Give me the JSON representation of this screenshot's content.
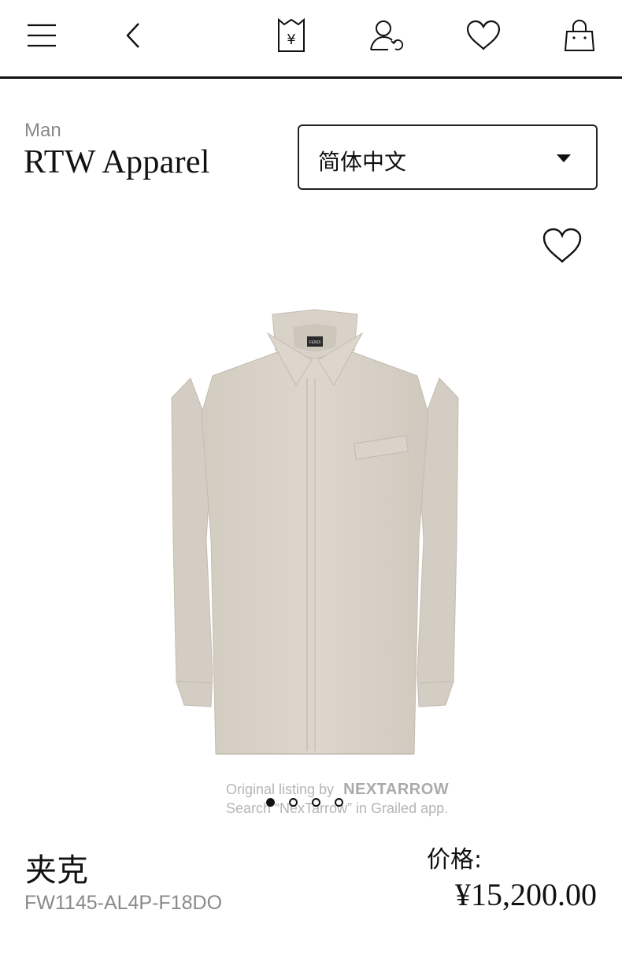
{
  "header": {
    "icons": [
      "menu-icon",
      "back-icon",
      "price-tag-icon",
      "account-icon",
      "heart-icon",
      "shopping-bag-icon"
    ]
  },
  "breadcrumb": "Man",
  "title": "RTW Apparel",
  "language_select": {
    "value": "简体中文"
  },
  "carousel": {
    "count": 4,
    "active": 1
  },
  "watermark": {
    "line1": "Original listing by",
    "brand": "NEXTARROW",
    "line2": "Search “NexTarrow” in Grailed app."
  },
  "product": {
    "name": "夹克",
    "code": "FW1145-AL4P-F18DO",
    "price_label": "价格:",
    "price": "¥15,200.00",
    "collar_label": "FENDI"
  },
  "colors": {
    "text": "#111111",
    "muted": "#8a8a8a",
    "fabric": "#d6d0c6"
  }
}
